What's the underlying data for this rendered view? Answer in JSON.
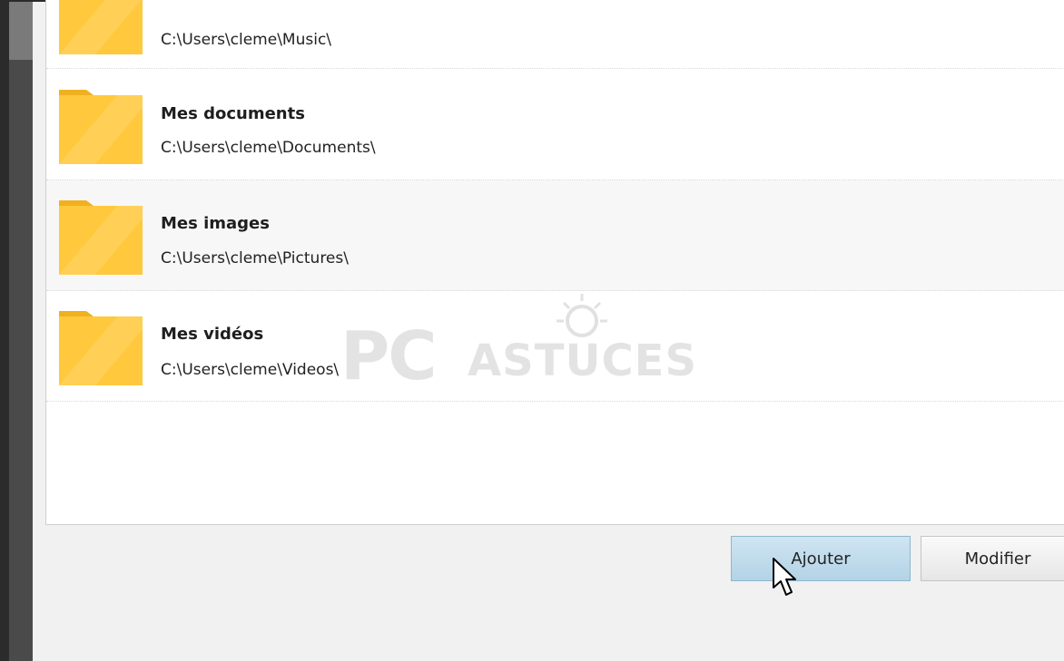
{
  "folders": [
    {
      "name": "",
      "path": "C:\\Users\\cleme\\Music\\",
      "icon": "folder-icon"
    },
    {
      "name": "Mes documents",
      "path": "C:\\Users\\cleme\\Documents\\",
      "icon": "folder-icon"
    },
    {
      "name": "Mes images",
      "path": "C:\\Users\\cleme\\Pictures\\",
      "icon": "folder-icon"
    },
    {
      "name": "Mes vidéos",
      "path": "C:\\Users\\cleme\\Videos\\",
      "icon": "folder-icon"
    }
  ],
  "buttons": {
    "add_label": "Ajouter",
    "edit_label": "Modifier"
  },
  "watermark": {
    "brand_pc": "PC",
    "brand_astuces": "ASTUCES"
  },
  "colors": {
    "folder": "#ffc83d",
    "folder_dark": "#f0b020",
    "add_button": "#b3d3e6"
  }
}
